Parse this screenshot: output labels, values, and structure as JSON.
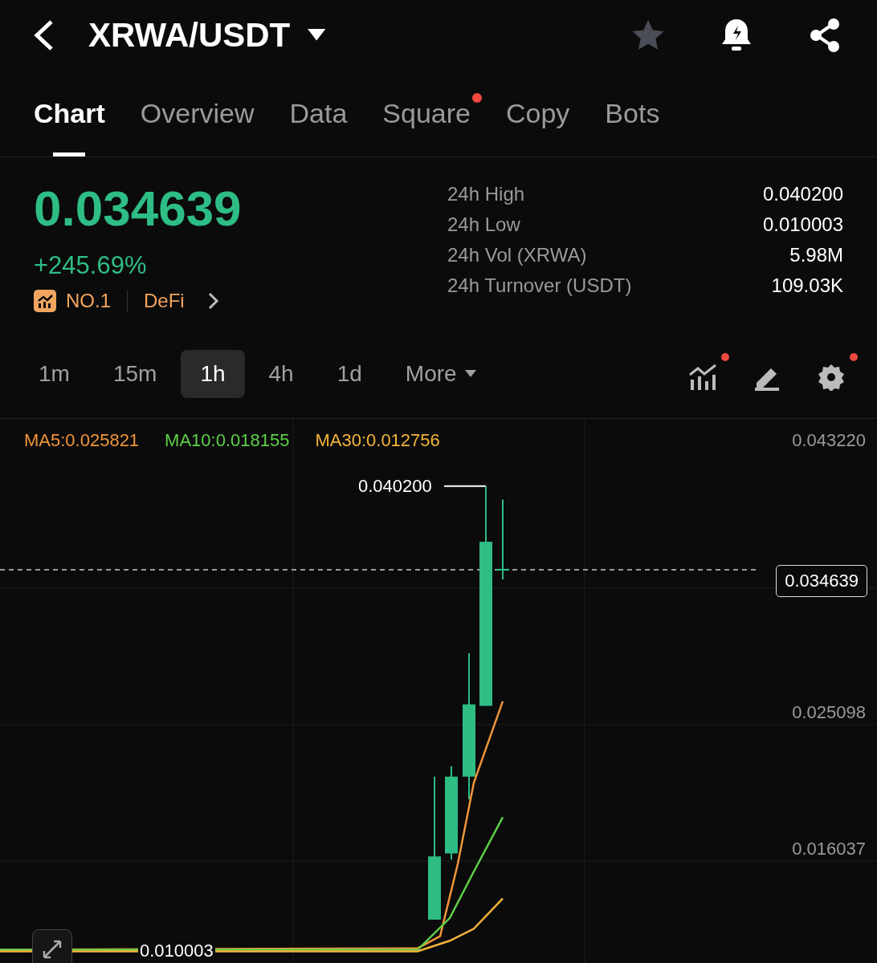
{
  "header": {
    "pair": "XRWA/USDT",
    "favorite": false
  },
  "tabs": [
    {
      "label": "Chart",
      "selected": true,
      "dot": false
    },
    {
      "label": "Overview",
      "selected": false,
      "dot": false
    },
    {
      "label": "Data",
      "selected": false,
      "dot": false
    },
    {
      "label": "Square",
      "selected": false,
      "dot": true
    },
    {
      "label": "Copy",
      "selected": false,
      "dot": false
    },
    {
      "label": "Bots",
      "selected": false,
      "dot": false
    }
  ],
  "price": {
    "value": "0.034639",
    "change": "+245.69%",
    "rank": "NO.1",
    "category": "DeFi"
  },
  "stats": [
    {
      "label": "24h High",
      "value": "0.040200"
    },
    {
      "label": "24h Low",
      "value": "0.010003"
    },
    {
      "label": "24h Vol (XRWA)",
      "value": "5.98M"
    },
    {
      "label": "24h Turnover (USDT)",
      "value": "109.03K"
    }
  ],
  "intervals": [
    {
      "label": "1m",
      "selected": false,
      "kind": "option"
    },
    {
      "label": "15m",
      "selected": false,
      "kind": "option"
    },
    {
      "label": "1h",
      "selected": true,
      "kind": "option"
    },
    {
      "label": "4h",
      "selected": false,
      "kind": "option"
    },
    {
      "label": "1d",
      "selected": false,
      "kind": "option"
    },
    {
      "label": "More",
      "selected": false,
      "kind": "dropdown"
    }
  ],
  "tools": [
    {
      "kind": "indicators",
      "dot": true
    },
    {
      "kind": "draw",
      "dot": false
    },
    {
      "kind": "settings",
      "dot": true
    }
  ],
  "chart": {
    "ma": [
      {
        "label": "MA5:0.025821",
        "color": "#f0953a"
      },
      {
        "label": "MA10:0.018155",
        "color": "#5fd04a"
      },
      {
        "label": "MA30:0.012756",
        "color": "#f5b53a"
      }
    ],
    "y_ticks": [
      "0.043220",
      "0.025098",
      "0.016037"
    ],
    "last_price": "0.034639",
    "high_label": "0.040200",
    "low_label": "0.010003"
  }
}
